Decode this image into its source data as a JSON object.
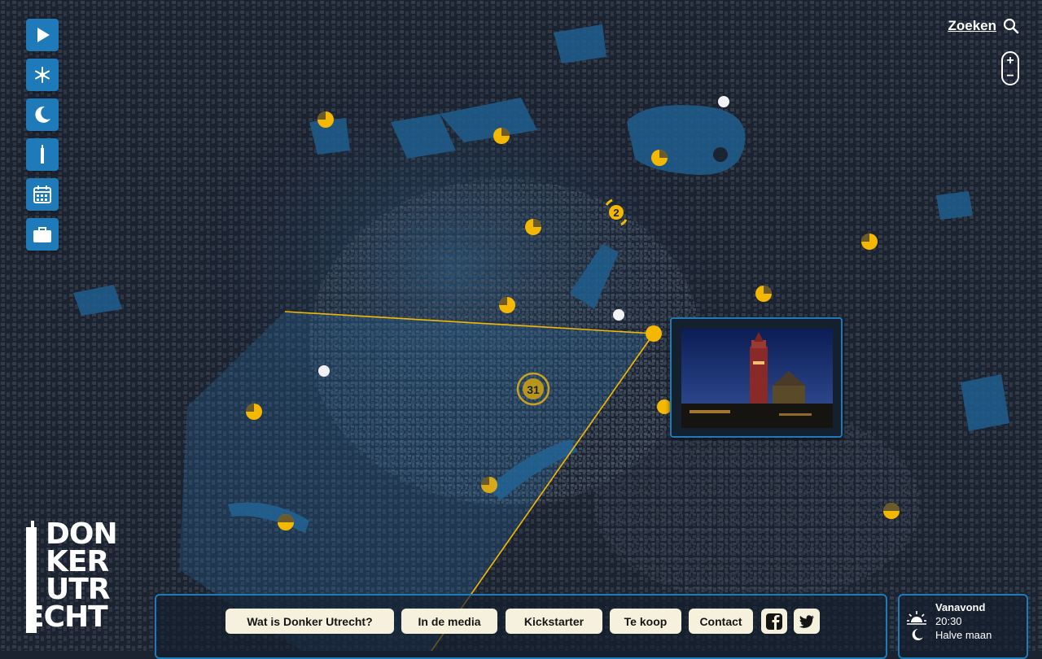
{
  "toolbar": {
    "buttons": [
      {
        "icon": "play-icon"
      },
      {
        "icon": "snowflake-icon"
      },
      {
        "icon": "moon-icon"
      },
      {
        "icon": "tower-icon"
      },
      {
        "icon": "calendar-icon"
      },
      {
        "icon": "briefcase-icon"
      }
    ]
  },
  "search": {
    "label": "Zoeken"
  },
  "zoom": {
    "in_label": "+",
    "out_label": "−"
  },
  "map": {
    "clusters": [
      {
        "count": "2"
      },
      {
        "count": "31"
      }
    ]
  },
  "logo": {
    "lines": [
      "DON",
      "KER",
      "UTR",
      "ECHT"
    ]
  },
  "nav": {
    "items": [
      "Wat is Donker Utrecht?",
      "In de media",
      "Kickstarter",
      "Te koop",
      "Contact"
    ],
    "social": [
      "facebook-icon",
      "twitter-icon"
    ]
  },
  "weather": {
    "label": "Vanavond",
    "time": "20:30",
    "moon_phase": "Halve maan"
  },
  "colors": {
    "accent": "#1e7ab8",
    "marker": "#f5b800",
    "background": "#1b2230",
    "button_bg": "#f6f1dd"
  }
}
